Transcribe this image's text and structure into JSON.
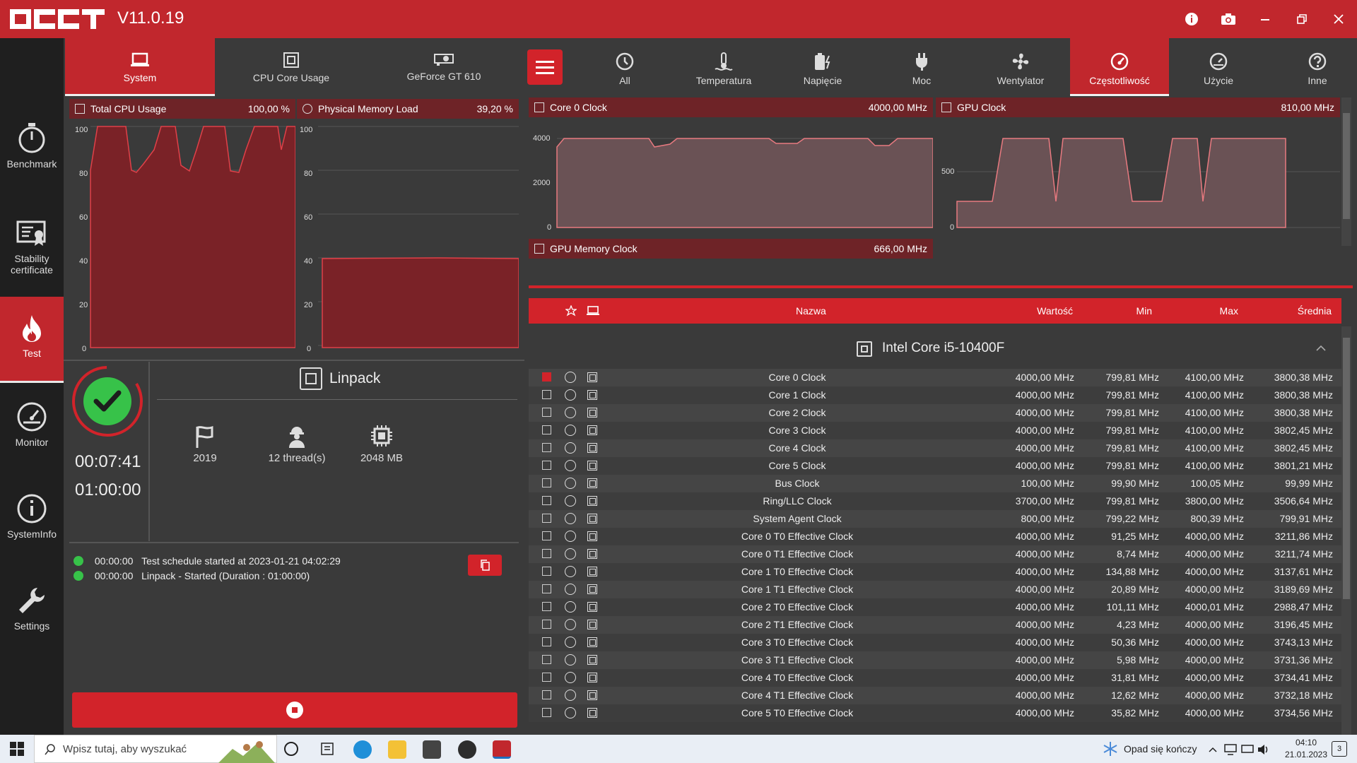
{
  "app": {
    "version": "V11.0.19"
  },
  "sidebar": {
    "items": [
      {
        "label": "Benchmark",
        "icon": "stopwatch-icon"
      },
      {
        "label": "Stability certificate",
        "icon": "certificate-icon"
      },
      {
        "label": "Test",
        "icon": "flame-icon",
        "active": true
      },
      {
        "label": "Monitor",
        "icon": "gauge-icon"
      },
      {
        "label": "SystemInfo",
        "icon": "info-icon"
      },
      {
        "label": "Settings",
        "icon": "wrench-icon"
      }
    ]
  },
  "left_tabs": [
    {
      "label": "System",
      "active": true
    },
    {
      "label": "CPU Core Usage"
    },
    {
      "label": "GeForce GT 610"
    }
  ],
  "charts_left": [
    {
      "title": "Total CPU Usage",
      "value": "100,00 %",
      "yticks": [
        "100",
        "80",
        "60",
        "40",
        "20",
        "0"
      ]
    },
    {
      "title": "Physical Memory Load",
      "value": "39,20 %",
      "yticks": [
        "100",
        "80",
        "60",
        "40",
        "20",
        "0"
      ]
    }
  ],
  "test": {
    "name": "Linpack",
    "elapsed": "00:07:41",
    "duration": "01:00:00",
    "params": [
      {
        "label": "2019",
        "icon": "flag-icon"
      },
      {
        "label": "12 thread(s)",
        "icon": "worker-icon"
      },
      {
        "label": "2048 MB",
        "icon": "memory-chip-icon"
      }
    ],
    "log": [
      {
        "time": "00:00:00",
        "text": "Test schedule started at 2023-01-21 04:02:29"
      },
      {
        "time": "00:00:00",
        "text": "Linpack - Started (Duration : 01:00:00)"
      }
    ]
  },
  "right_tabs": [
    {
      "label": "All"
    },
    {
      "label": "Temperatura"
    },
    {
      "label": "Napięcie"
    },
    {
      "label": "Moc"
    },
    {
      "label": "Wentylator"
    },
    {
      "label": "Częstotliwość",
      "active": true
    },
    {
      "label": "Użycie"
    },
    {
      "label": "Inne"
    }
  ],
  "charts_right": [
    {
      "title": "Core 0 Clock",
      "value": "4000,00 MHz",
      "yticks": [
        "4000",
        "2000",
        "0"
      ]
    },
    {
      "title": "GPU Clock",
      "value": "810,00 MHz",
      "yticks": [
        "500",
        "0"
      ]
    },
    {
      "title": "GPU Memory Clock",
      "value": "666,00 MHz"
    }
  ],
  "table": {
    "headers": {
      "name": "Nazwa",
      "value": "Wartość",
      "min": "Min",
      "max": "Max",
      "avg": "Średnia"
    },
    "group": "Intel Core i5-10400F",
    "rows": [
      {
        "name": "Core 0 Clock",
        "value": "4000,00 MHz",
        "min": "799,81 MHz",
        "max": "4100,00 MHz",
        "avg": "3800,38 MHz",
        "checked": true
      },
      {
        "name": "Core 1 Clock",
        "value": "4000,00 MHz",
        "min": "799,81 MHz",
        "max": "4100,00 MHz",
        "avg": "3800,38 MHz"
      },
      {
        "name": "Core 2 Clock",
        "value": "4000,00 MHz",
        "min": "799,81 MHz",
        "max": "4100,00 MHz",
        "avg": "3800,38 MHz"
      },
      {
        "name": "Core 3 Clock",
        "value": "4000,00 MHz",
        "min": "799,81 MHz",
        "max": "4100,00 MHz",
        "avg": "3802,45 MHz"
      },
      {
        "name": "Core 4 Clock",
        "value": "4000,00 MHz",
        "min": "799,81 MHz",
        "max": "4100,00 MHz",
        "avg": "3802,45 MHz"
      },
      {
        "name": "Core 5 Clock",
        "value": "4000,00 MHz",
        "min": "799,81 MHz",
        "max": "4100,00 MHz",
        "avg": "3801,21 MHz"
      },
      {
        "name": "Bus Clock",
        "value": "100,00 MHz",
        "min": "99,90 MHz",
        "max": "100,05 MHz",
        "avg": "99,99 MHz"
      },
      {
        "name": "Ring/LLC Clock",
        "value": "3700,00 MHz",
        "min": "799,81 MHz",
        "max": "3800,00 MHz",
        "avg": "3506,64 MHz"
      },
      {
        "name": "System Agent Clock",
        "value": "800,00 MHz",
        "min": "799,22 MHz",
        "max": "800,39 MHz",
        "avg": "799,91 MHz"
      },
      {
        "name": "Core 0 T0 Effective Clock",
        "value": "4000,00 MHz",
        "min": "91,25 MHz",
        "max": "4000,00 MHz",
        "avg": "3211,86 MHz"
      },
      {
        "name": "Core 0 T1 Effective Clock",
        "value": "4000,00 MHz",
        "min": "8,74 MHz",
        "max": "4000,00 MHz",
        "avg": "3211,74 MHz"
      },
      {
        "name": "Core 1 T0 Effective Clock",
        "value": "4000,00 MHz",
        "min": "134,88 MHz",
        "max": "4000,00 MHz",
        "avg": "3137,61 MHz"
      },
      {
        "name": "Core 1 T1 Effective Clock",
        "value": "4000,00 MHz",
        "min": "20,89 MHz",
        "max": "4000,00 MHz",
        "avg": "3189,69 MHz"
      },
      {
        "name": "Core 2 T0 Effective Clock",
        "value": "4000,00 MHz",
        "min": "101,11 MHz",
        "max": "4000,01 MHz",
        "avg": "2988,47 MHz"
      },
      {
        "name": "Core 2 T1 Effective Clock",
        "value": "4000,00 MHz",
        "min": "4,23 MHz",
        "max": "4000,00 MHz",
        "avg": "3196,45 MHz"
      },
      {
        "name": "Core 3 T0 Effective Clock",
        "value": "4000,00 MHz",
        "min": "50,36 MHz",
        "max": "4000,00 MHz",
        "avg": "3743,13 MHz"
      },
      {
        "name": "Core 3 T1 Effective Clock",
        "value": "4000,00 MHz",
        "min": "5,98 MHz",
        "max": "4000,00 MHz",
        "avg": "3731,36 MHz"
      },
      {
        "name": "Core 4 T0 Effective Clock",
        "value": "4000,00 MHz",
        "min": "31,81 MHz",
        "max": "4000,00 MHz",
        "avg": "3734,41 MHz"
      },
      {
        "name": "Core 4 T1 Effective Clock",
        "value": "4000,00 MHz",
        "min": "12,62 MHz",
        "max": "4000,00 MHz",
        "avg": "3732,18 MHz"
      },
      {
        "name": "Core 5 T0 Effective Clock",
        "value": "4000,00 MHz",
        "min": "35,82 MHz",
        "max": "4000,00 MHz",
        "avg": "3734,56 MHz"
      }
    ]
  },
  "taskbar": {
    "search_placeholder": "Wpisz tutaj, aby wyszukać",
    "weather": "Opad się kończy",
    "time": "04:10",
    "date": "21.01.2023",
    "notifications": "3"
  },
  "colors": {
    "accent": "#c1272d",
    "dark": "#2d2d2d",
    "chart_fill": "#6e2327"
  }
}
